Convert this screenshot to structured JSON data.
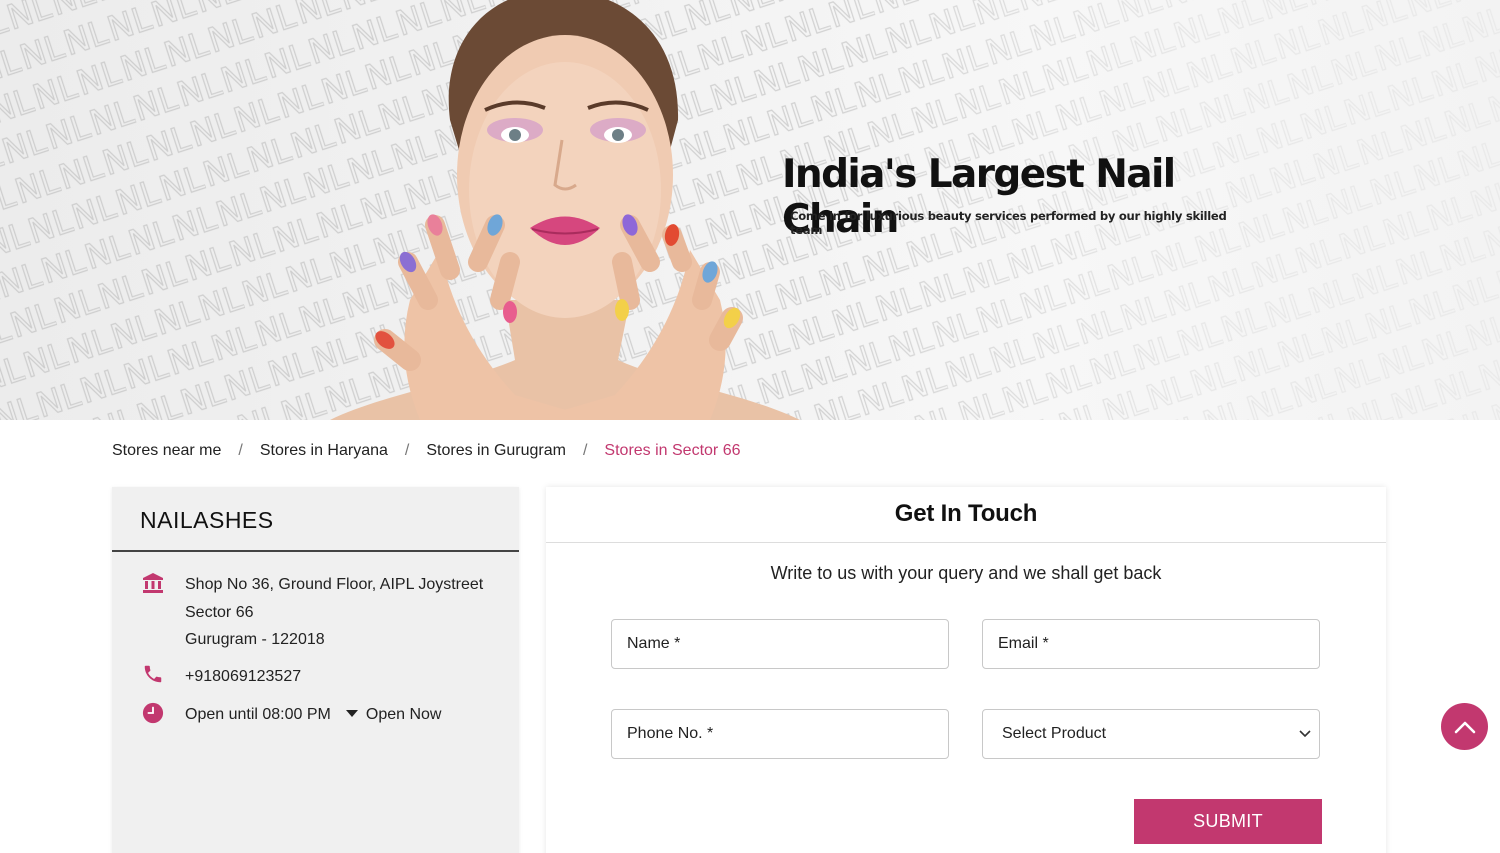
{
  "colors": {
    "accent": "#c2386f",
    "card_bg": "#f0f0f0",
    "hero_bg": "#f2f2f2"
  },
  "hero": {
    "title": "India's Largest Nail Chain",
    "subtitle": "Come in for luxurious beauty services performed by our highly skilled team",
    "pattern_text": "NL",
    "image": "model-with-painted-nails"
  },
  "breadcrumb": {
    "items": [
      {
        "label": "Stores near me"
      },
      {
        "label": "Stores in Haryana"
      },
      {
        "label": "Stores in Gurugram"
      },
      {
        "label": "Stores in Sector 66",
        "current": true
      }
    ],
    "separator": "/"
  },
  "store": {
    "name": "NAILASHES",
    "address_lines": [
      "Shop No 36, Ground Floor, AIPL Joystreet",
      "Sector 66",
      "Gurugram - 122018"
    ],
    "phone": "+918069123527",
    "hours": "Open until 08:00 PM",
    "status": "Open Now",
    "icons": {
      "address": "bank-icon",
      "phone": "phone-icon",
      "hours": "clock-icon",
      "status": "caret-down-icon"
    }
  },
  "contact": {
    "title": "Get In Touch",
    "subtitle": "Write to us with your query and we shall get back",
    "name_placeholder": "Name *",
    "email_placeholder": "Email *",
    "phone_placeholder": "Phone No. *",
    "product_select": "Select Product",
    "submit_label": "SUBMIT"
  },
  "scroll_top": {
    "icon": "chevron-up-icon"
  }
}
